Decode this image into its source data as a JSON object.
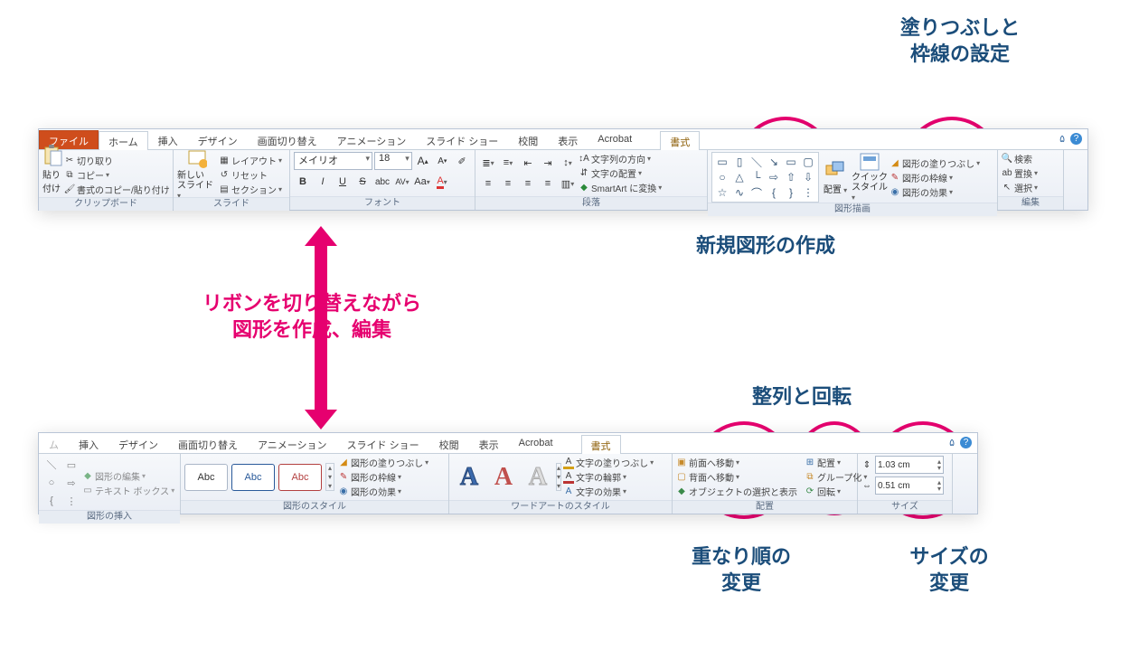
{
  "callouts": {
    "fill_outline": "塗りつぶしと\n枠線の設定",
    "new_shape": "新規図形の作成",
    "align_rotate": "整列と回転",
    "order": "重なり順の\n変更",
    "size": "サイズの\n変更",
    "ribbon_switch": "リボンを切り替えながら\n図形を作成、編集"
  },
  "ribbon1": {
    "tabs": {
      "file": "ファイル",
      "home": "ホーム",
      "insert": "挿入",
      "design": "デザイン",
      "transition": "画面切り替え",
      "animation": "アニメーション",
      "slideshow": "スライド ショー",
      "review": "校閲",
      "view": "表示",
      "acrobat": "Acrobat",
      "format": "書式"
    },
    "clipboard": {
      "title": "クリップボード",
      "paste": "貼り付け",
      "cut": "切り取り",
      "copy": "コピー",
      "painter": "書式のコピー/貼り付け"
    },
    "slides": {
      "title": "スライド",
      "new": "新しい\nスライド",
      "layout": "レイアウト",
      "reset": "リセット",
      "section": "セクション"
    },
    "font": {
      "title": "フォント",
      "name": "メイリオ",
      "size": "18"
    },
    "paragraph": {
      "title": "段落",
      "textdir": "文字列の方向",
      "align": "文字の配置",
      "smartart": "SmartArt に変換"
    },
    "drawing": {
      "title": "図形描画",
      "arrange": "配置",
      "quick": "クイック\nスタイル",
      "fill": "図形の塗りつぶし",
      "outline": "図形の枠線",
      "effects": "図形の効果"
    },
    "editing": {
      "title": "編集",
      "find": "検索",
      "replace": "置換",
      "select": "選択"
    }
  },
  "ribbon2": {
    "tabs": {
      "insert": "挿入",
      "design": "デザイン",
      "transition": "画面切り替え",
      "animation": "アニメーション",
      "slideshow": "スライド ショー",
      "review": "校閲",
      "view": "表示",
      "acrobat": "Acrobat",
      "format": "書式"
    },
    "insertshapes": {
      "title": "図形の挿入",
      "editshape": "図形の編集",
      "textbox": "テキスト ボックス"
    },
    "shapestyles": {
      "title": "図形のスタイル",
      "fill": "図形の塗りつぶし",
      "outline": "図形の枠線",
      "effects": "図形の効果",
      "sample": "Abc"
    },
    "wordart": {
      "title": "ワードアートのスタイル",
      "textfill": "文字の塗りつぶし",
      "textoutline": "文字の輪郭",
      "texteffects": "文字の効果"
    },
    "arrange": {
      "title": "配置",
      "front": "前面へ移動",
      "back": "背面へ移動",
      "selpane": "オブジェクトの選択と表示",
      "align": "配置",
      "group": "グループ化",
      "rotate": "回転"
    },
    "size": {
      "title": "サイズ",
      "h": "1.03 cm",
      "w": "0.51 cm"
    }
  }
}
